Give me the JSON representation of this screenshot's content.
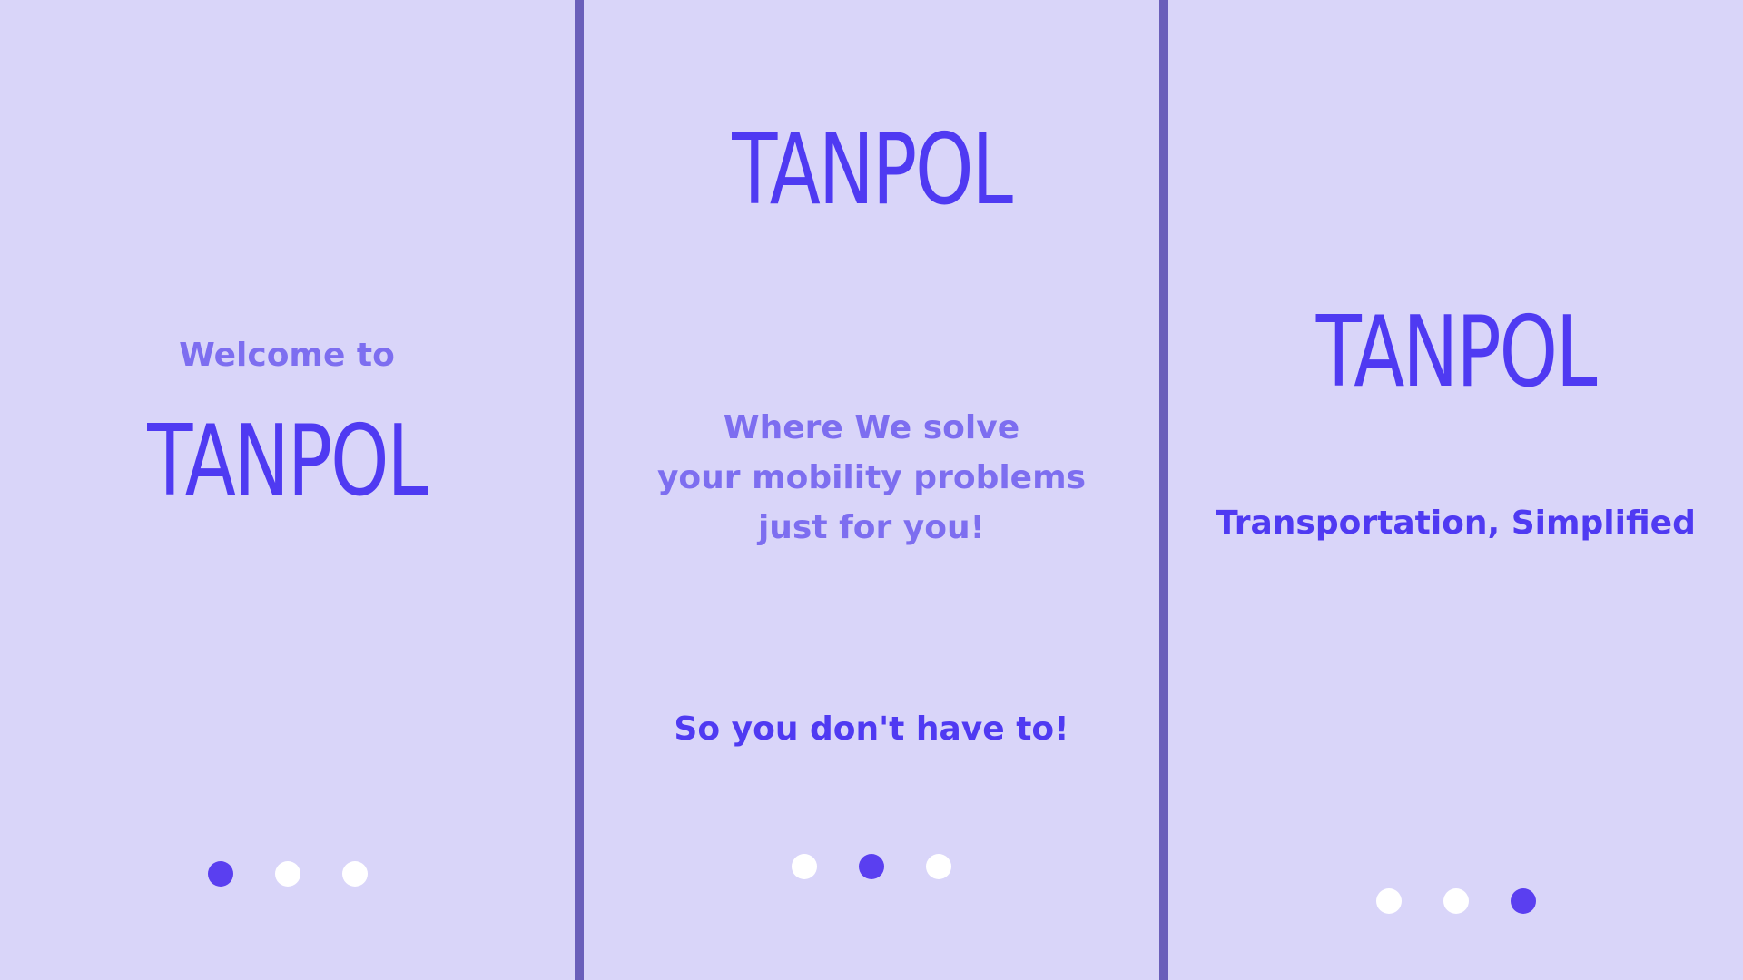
{
  "colors": {
    "background": "#d9d5f9",
    "divider": "#6a5fba",
    "brand": "#4f3af2",
    "text_light": "#7d6ef0",
    "dot_inactive": "#ffffff",
    "dot_active": "#5a3ff0"
  },
  "screens": [
    {
      "welcome": "Welcome to",
      "logo": "TANPOL",
      "pagination": {
        "current": 1,
        "total": 3
      }
    },
    {
      "logo": "TANPOL",
      "tagline_lines": [
        "Where We solve",
        "your mobility problems",
        "just for you!"
      ],
      "cta_text": "So you don't have to!",
      "pagination": {
        "current": 2,
        "total": 3
      }
    },
    {
      "logo": "TANPOL",
      "tagline": "Transportation, Simplified",
      "pagination": {
        "current": 3,
        "total": 3
      }
    }
  ]
}
